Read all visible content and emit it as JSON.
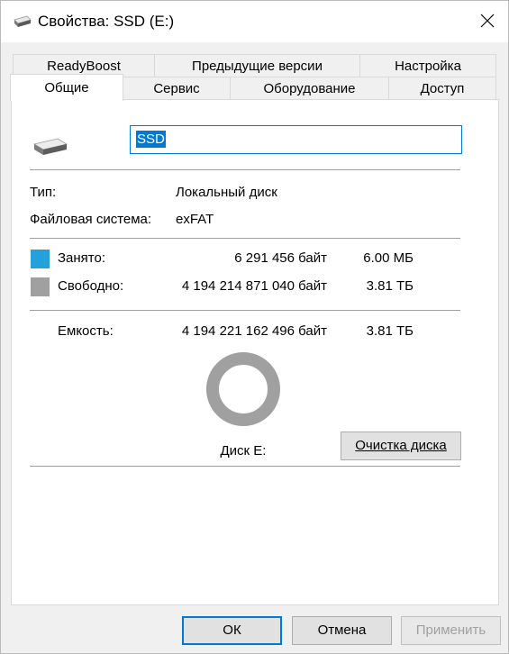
{
  "window": {
    "title": "Свойства: SSD (E:)",
    "title_icon": "drive-icon",
    "close_icon": "close-icon"
  },
  "tabs": {
    "row_back": [
      {
        "label": "ReadyBoost"
      },
      {
        "label": "Предыдущие версии"
      },
      {
        "label": "Настройка"
      }
    ],
    "row_front": [
      {
        "label": "Общие",
        "active": true
      },
      {
        "label": "Сервис"
      },
      {
        "label": "Оборудование"
      },
      {
        "label": "Доступ"
      }
    ]
  },
  "general": {
    "volume_name": "SSD",
    "type_label": "Тип:",
    "type_value": "Локальный диск",
    "fs_label": "Файловая система:",
    "fs_value": "exFAT",
    "used": {
      "label": "Занято:",
      "bytes": "6 291 456 байт",
      "size": "6.00 МБ",
      "color": "#26a0da"
    },
    "free": {
      "label": "Свободно:",
      "bytes": "4 194 214 871 040 байт",
      "size": "3.81 ТБ",
      "color": "#a0a0a0"
    },
    "capacity": {
      "label": "Емкость:",
      "bytes": "4 194 221 162 496 байт",
      "size": "3.81 ТБ"
    },
    "usage_fraction": 1.5e-06,
    "disk_label": "Диск E:",
    "cleanup_button": "Очистка диска"
  },
  "buttons": {
    "ok": "ОК",
    "cancel": "Отмена",
    "apply": "Применить"
  }
}
